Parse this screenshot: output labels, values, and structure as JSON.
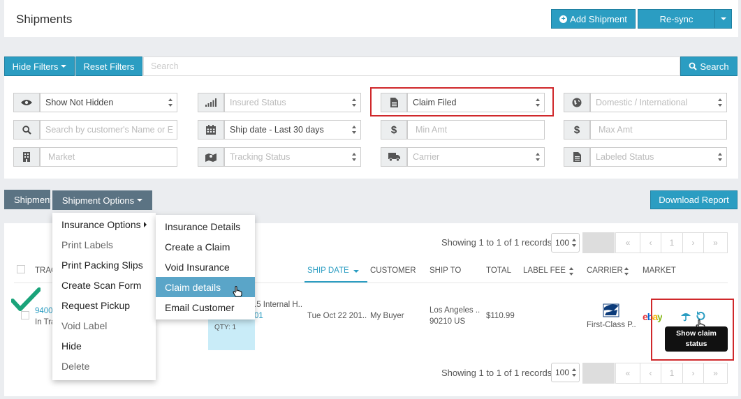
{
  "header": {
    "title": "Shipments",
    "add_shipment_label": "Add Shipment",
    "resync_label": "Re-sync"
  },
  "filter_bar": {
    "hide_filters_label": "Hide Filters",
    "reset_filters_label": "Reset Filters",
    "search_placeholder": "Search",
    "search_button_label": "Search"
  },
  "filters": {
    "visibility": "Show Not Hidden",
    "insured_status": "Insured Status",
    "claim_status": "Claim Filed",
    "domestic_international": "Domestic / International",
    "customer_search": "Search by customer's Name or E",
    "ship_date": "Ship date - Last 30 days",
    "min_amt": "Min Amt",
    "max_amt": "Max Amt",
    "market": "Market",
    "tracking_status": "Tracking Status",
    "carrier": "Carrier",
    "labeled_status": "Labeled Status"
  },
  "toolbar": {
    "shipments_tab_label": "Shipment",
    "shipment_options_label": "Shipment Options",
    "download_report_label": "Download Report"
  },
  "pagination": {
    "showing_text": "Showing 1 to 1 of 1 records",
    "page_size": "100",
    "first": "«",
    "prev": "‹",
    "page": "1",
    "next": "›",
    "last": "»"
  },
  "table": {
    "columns": {
      "tracking": "TRAC",
      "ship_date": "SHIP DATE",
      "customer": "CUSTOMER",
      "ship_to": "SHIP TO",
      "total": "TOTAL",
      "label_fee": "LABEL FEE",
      "carrier": "CARRIER",
      "market": "MARKET"
    },
    "row": {
      "tracking": "9400",
      "tracking_status": "In Tra",
      "item_title": ".5 Internal H..",
      "item_id": "01",
      "qty": "QTY: 1",
      "ship_date": "Tue Oct 22 201..",
      "customer": "My Buyer",
      "ship_to_city": "Los Angeles ..",
      "ship_to_zip": "90210 US",
      "total": "$110.99",
      "carrier_service": "First-Class P..",
      "market": "ebay"
    }
  },
  "shipment_options_menu": [
    {
      "label": "Insurance Options",
      "has_submenu": true
    },
    {
      "label": "Print Labels"
    },
    {
      "label": "Print Packing Slips"
    },
    {
      "label": "Create Scan Form"
    },
    {
      "label": "Request Pickup"
    },
    {
      "label": "Void Label"
    },
    {
      "label": "Hide"
    },
    {
      "label": "Delete"
    }
  ],
  "insurance_submenu": [
    {
      "label": "Insurance Details"
    },
    {
      "label": "Create a Claim"
    },
    {
      "label": "Void Insurance"
    },
    {
      "label": "Claim details",
      "active": true
    },
    {
      "label": "Email Customer"
    }
  ],
  "tooltip": {
    "text": "Show claim status"
  },
  "colors": {
    "primary": "#2b9dc2",
    "toolbar_gray": "#5b7383",
    "highlight_red": "#d0282b",
    "menu_active": "#5aa5c8",
    "check_green": "#1aa37a"
  }
}
